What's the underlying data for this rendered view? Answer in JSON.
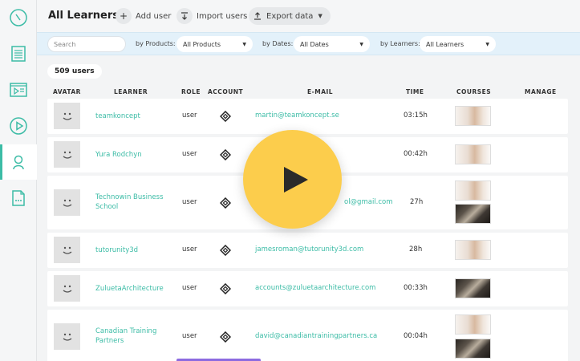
{
  "header": {
    "title": "All Learners",
    "add_user": "Add user",
    "import_users": "Import users",
    "export_data": "Export data"
  },
  "filters": {
    "search_placeholder": "Search",
    "products_label": "by Products:",
    "products_value": "All Products",
    "dates_label": "by Dates:",
    "dates_value": "All Dates",
    "learners_label": "by Learners:",
    "learners_value": "All Learners"
  },
  "table": {
    "count": "509 users",
    "columns": [
      "AVATAR",
      "LEARNER",
      "ROLE",
      "ACCOUNT",
      "E-MAIL",
      "TIME",
      "COURSES",
      "MANAGE"
    ],
    "rows": [
      {
        "learner": "teamkoncept",
        "role": "user",
        "email": "martin@teamkoncept.se",
        "time": "03:15h"
      },
      {
        "learner": "Yura Rodchyn",
        "role": "user",
        "email": "",
        "time": "00:42h"
      },
      {
        "learner": "Technowin Business School",
        "role": "user",
        "email": "ol@gmail.com",
        "time": "27h"
      },
      {
        "learner": "tutorunity3d",
        "role": "user",
        "email": "jamesroman@tutorunity3d.com",
        "time": "28h"
      },
      {
        "learner": "ZuluetaArchitecture",
        "role": "user",
        "email": "accounts@zuluetaarchitecture.com",
        "time": "00:33h"
      },
      {
        "learner": "Canadian Training Partners",
        "role": "user",
        "email": "david@canadiantrainingpartners.ca",
        "time": "00:04h"
      }
    ]
  },
  "colors": {
    "accent": "#3cbca6",
    "play_button": "#fccd4c",
    "filter_bar": "#e3f1fa"
  },
  "icons": {
    "sidebar": [
      "gauge-icon",
      "document-list-icon",
      "slideshow-icon",
      "play-circle-icon",
      "user-icon",
      "file-icon"
    ],
    "account": "diamond-icon",
    "avatar": "smiley-icon"
  }
}
